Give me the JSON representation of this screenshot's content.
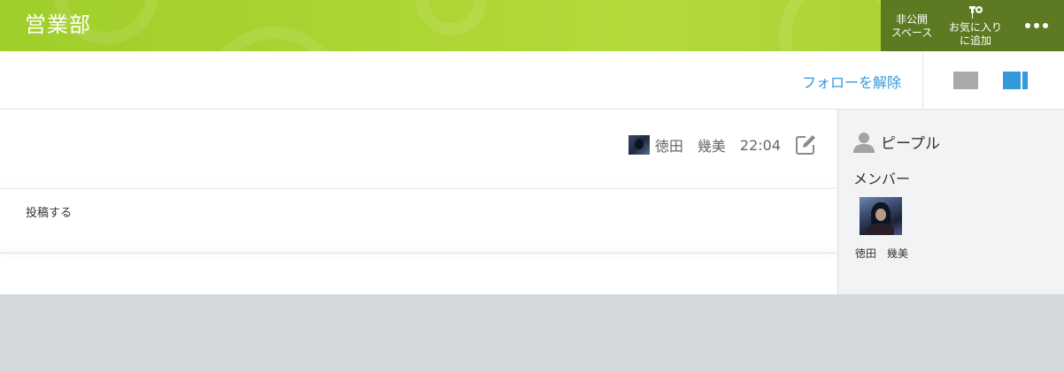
{
  "header": {
    "space_title": "営業部",
    "private_line1": "非公開",
    "private_line2": "スペース",
    "favorite_line1": "お気に入り",
    "favorite_line2": "に追加",
    "more_icon": "ellipsis-icon",
    "background_color": "#a6d132",
    "actions_color": "#5c7a22"
  },
  "toolbar": {
    "unfollow_label": "フォローを解除",
    "link_color": "#3498db",
    "layout_icons": [
      "single-column-layout-icon",
      "two-column-layout-icon"
    ]
  },
  "post": {
    "author": "徳田　幾美",
    "time": "22:04",
    "edit_icon": "edit-icon"
  },
  "composer": {
    "label": "投稿する"
  },
  "sidebar": {
    "people_title": "ピープル",
    "people_icon": "person-icon",
    "members_label": "メンバー",
    "members": [
      {
        "name": "徳田　幾美"
      }
    ]
  }
}
